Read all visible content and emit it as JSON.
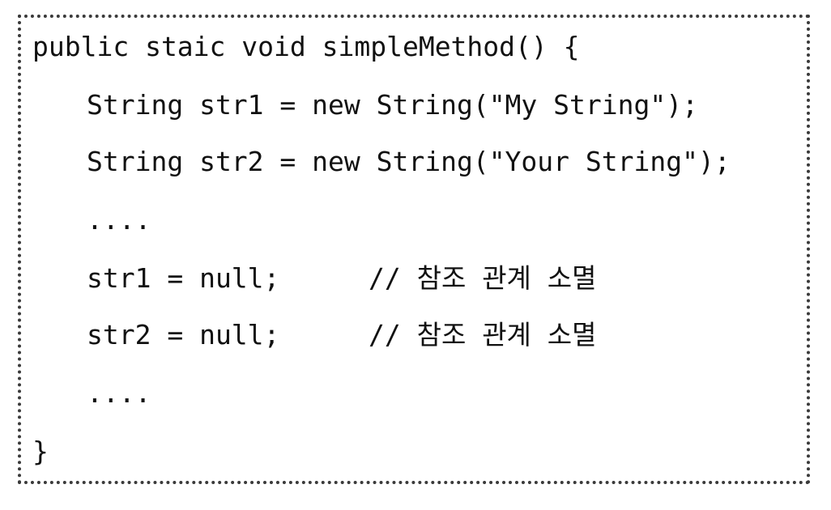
{
  "code": {
    "lines": [
      "public staic void simpleMethod() {",
      "String str1 = new String(\"My String\");",
      "String str2 = new String(\"Your String\");",
      "....",
      "str1 = null;",
      "str2 = null;",
      "....",
      "}"
    ],
    "comments": {
      "line4": "// 참조 관계 소멸",
      "line5": "// 참조 관계 소멸"
    }
  }
}
